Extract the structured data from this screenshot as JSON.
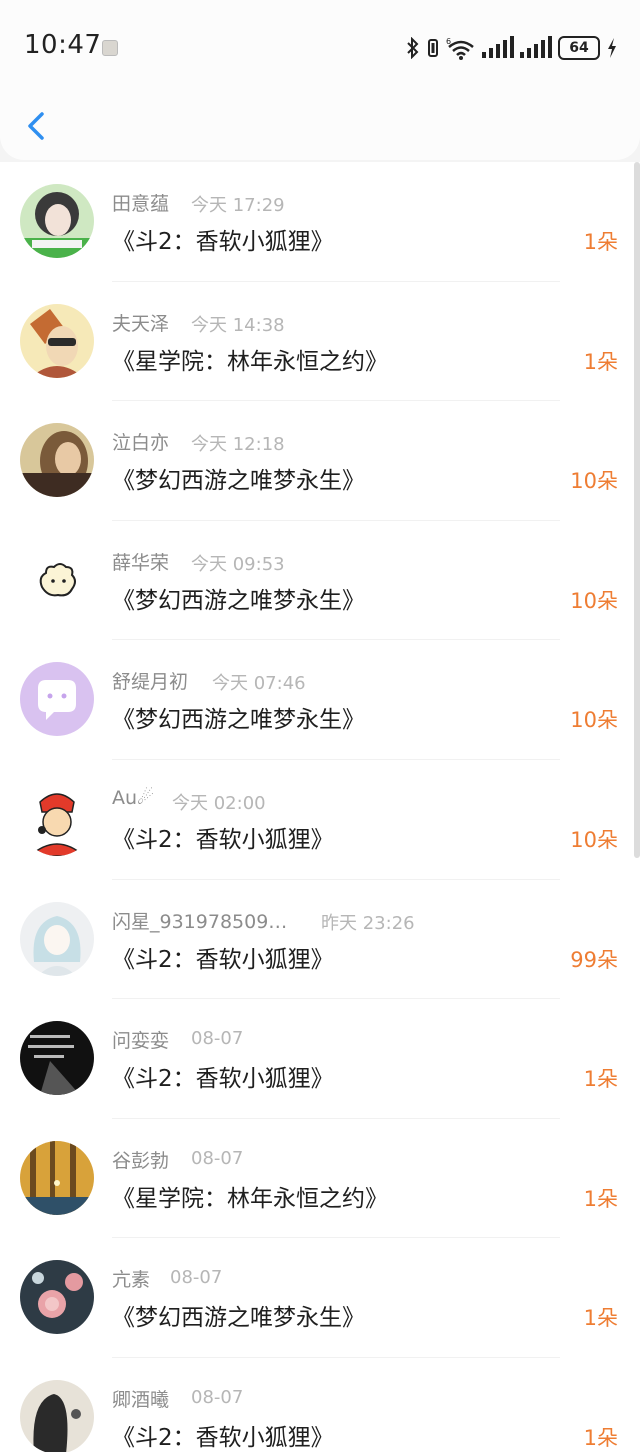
{
  "status_bar": {
    "time": "10:47",
    "battery": "64"
  },
  "header": {
    "back_icon": "chevron-left-icon",
    "accent": "#2f8ff0"
  },
  "colors": {
    "flower_count": "#ee7d33",
    "name": "#8c8c8c",
    "timestamp": "#b6b6b6"
  },
  "records": [
    {
      "name": "田意蕴",
      "time": "今天 17:29",
      "gift": "《斗2：香软小狐狸》",
      "flowers": "1朵"
    },
    {
      "name": "夫天泽",
      "time": "今天 14:38",
      "gift": "《星学院：林年永恒之约》",
      "flowers": "1朵"
    },
    {
      "name": "泣白亦",
      "time": "今天 12:18",
      "gift": "《梦幻西游之唯梦永生》",
      "flowers": "10朵"
    },
    {
      "name": "薛华荣",
      "time": "今天 09:53",
      "gift": "《梦幻西游之唯梦永生》",
      "flowers": "10朵"
    },
    {
      "name": "舒缇月初",
      "time": "今天 07:46",
      "gift": "《梦幻西游之唯梦永生》",
      "flowers": "10朵"
    },
    {
      "name": "Au☄",
      "time": "今天 02:00",
      "gift": "《斗2：香软小狐狸》",
      "flowers": "10朵"
    },
    {
      "name": "闪星_931978509…",
      "time": "昨天 23:26",
      "gift": "《斗2：香软小狐狸》",
      "flowers": "99朵"
    },
    {
      "name": "问娈娈",
      "time": "08-07",
      "gift": "《斗2：香软小狐狸》",
      "flowers": "1朵"
    },
    {
      "name": "谷彭勃",
      "time": "08-07",
      "gift": "《星学院：林年永恒之约》",
      "flowers": "1朵"
    },
    {
      "name": "亢素",
      "time": "08-07",
      "gift": "《梦幻西游之唯梦永生》",
      "flowers": "1朵"
    },
    {
      "name": "卿酒曦",
      "time": "08-07",
      "gift": "《斗2：香软小狐狸》",
      "flowers": "1朵"
    }
  ]
}
